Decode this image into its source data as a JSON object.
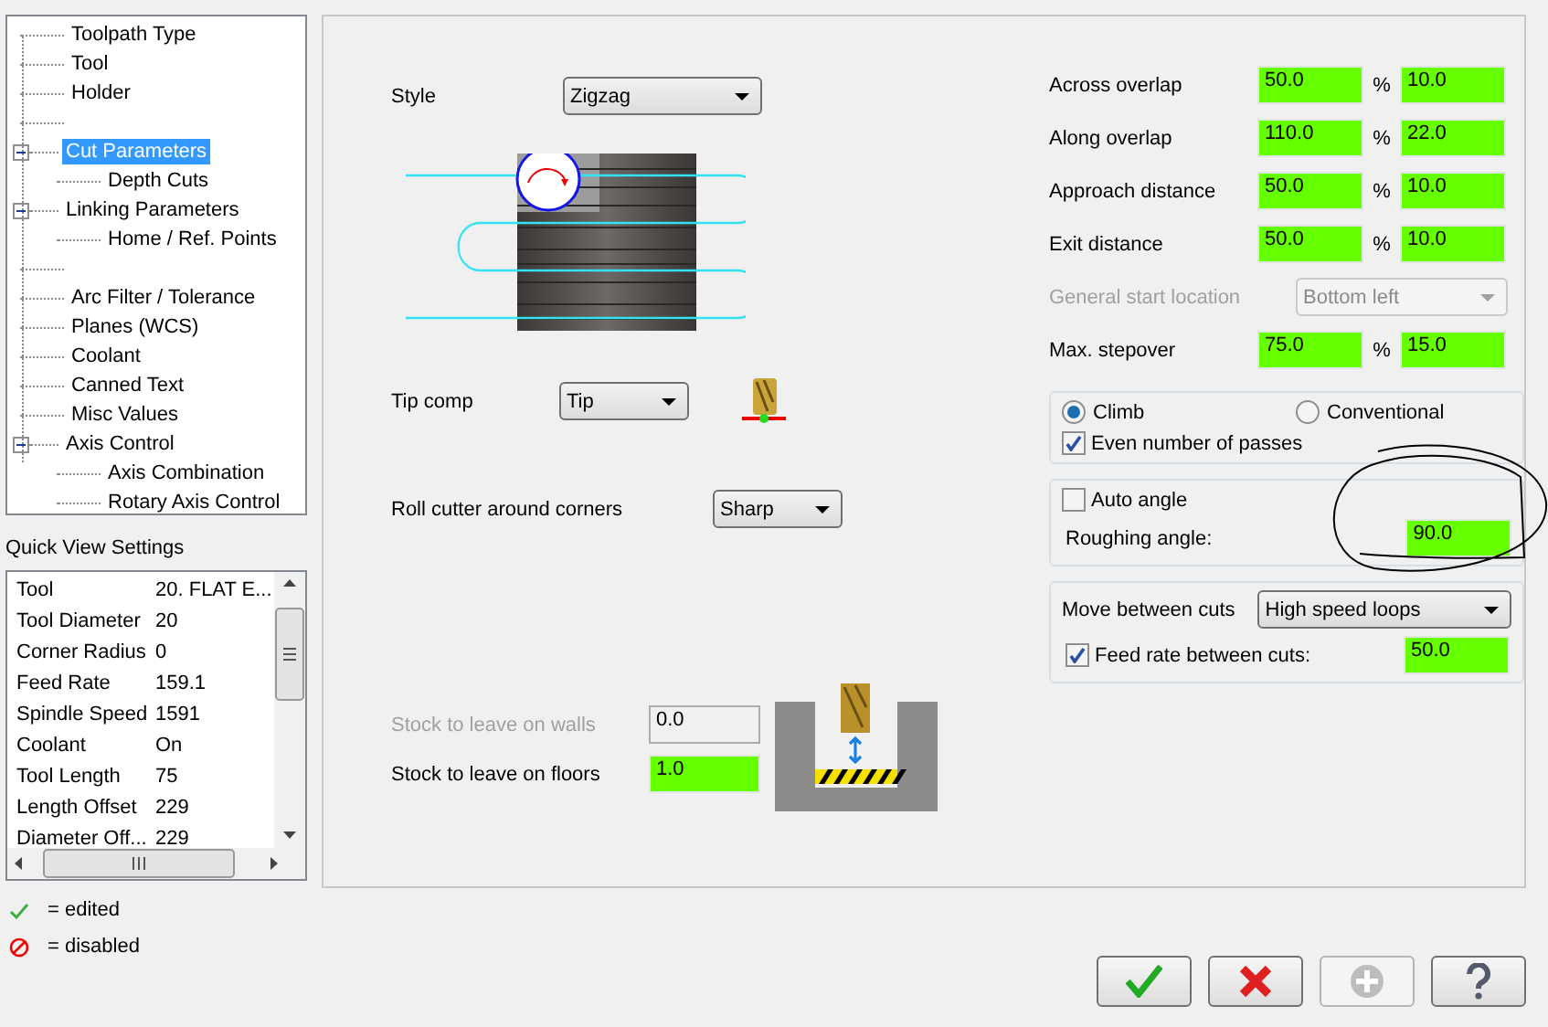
{
  "tree": [
    {
      "kind": "item",
      "label": "Toolpath Type",
      "selected": false
    },
    {
      "kind": "item",
      "label": "Tool",
      "selected": false
    },
    {
      "kind": "item",
      "label": "Holder",
      "selected": false
    },
    {
      "kind": "blank"
    },
    {
      "kind": "item",
      "label": "Cut Parameters",
      "selected": true,
      "expanded": true,
      "children": [
        {
          "kind": "item",
          "label": "Depth Cuts",
          "selected": false
        }
      ]
    },
    {
      "kind": "item",
      "label": "Linking Parameters",
      "selected": false,
      "expanded": true,
      "children": [
        {
          "kind": "item",
          "label": "Home / Ref. Points",
          "selected": false
        }
      ]
    },
    {
      "kind": "blank"
    },
    {
      "kind": "item",
      "label": "Arc Filter / Tolerance",
      "selected": false
    },
    {
      "kind": "item",
      "label": "Planes (WCS)",
      "selected": false
    },
    {
      "kind": "item",
      "label": "Coolant",
      "selected": false
    },
    {
      "kind": "item",
      "label": "Canned Text",
      "selected": false
    },
    {
      "kind": "item",
      "label": "Misc Values",
      "selected": false
    },
    {
      "kind": "item",
      "label": "Axis Control",
      "selected": false,
      "expanded": true,
      "children": [
        {
          "kind": "item",
          "label": "Axis Combination",
          "selected": false
        },
        {
          "kind": "item",
          "label": "Rotary Axis Control",
          "selected": false
        }
      ]
    }
  ],
  "quick_view": {
    "title": "Quick View Settings",
    "rows": [
      {
        "label": "Tool",
        "value": "20. FLAT E..."
      },
      {
        "label": "Tool Diameter",
        "value": "20"
      },
      {
        "label": "Corner Radius",
        "value": "0"
      },
      {
        "label": "Feed Rate",
        "value": "159.1"
      },
      {
        "label": "Spindle Speed",
        "value": "1591"
      },
      {
        "label": "Coolant",
        "value": "On"
      },
      {
        "label": "Tool Length",
        "value": "75"
      },
      {
        "label": "Length Offset",
        "value": "229"
      },
      {
        "label": "Diameter Off...",
        "value": "229"
      }
    ]
  },
  "legend": [
    {
      "kind": "edited",
      "label": "= edited"
    },
    {
      "kind": "disabled",
      "label": "= disabled"
    }
  ],
  "style": {
    "label": "Style",
    "value": "Zigzag"
  },
  "tip_comp": {
    "label": "Tip comp",
    "value": "Tip"
  },
  "roll_cutter": {
    "label": "Roll cutter around corners",
    "value": "Sharp"
  },
  "stock": [
    {
      "label": "Stock to leave on walls",
      "value": "0.0",
      "disabled": true,
      "edited": false
    },
    {
      "label": "Stock to leave on floors",
      "value": "1.0",
      "disabled": false,
      "edited": true
    }
  ],
  "params": [
    {
      "kind": "pair",
      "label": "Across overlap",
      "percent": "50.0",
      "unit": "%",
      "value": "10.0",
      "edited": true
    },
    {
      "kind": "pair",
      "label": "Along overlap",
      "percent": "110.0",
      "unit": "%",
      "value": "22.0",
      "edited": true
    },
    {
      "kind": "pair",
      "label": "Approach distance",
      "percent": "50.0",
      "unit": "%",
      "value": "10.0",
      "edited": true
    },
    {
      "kind": "pair",
      "label": "Exit distance",
      "percent": "50.0",
      "unit": "%",
      "value": "10.0",
      "edited": true
    },
    {
      "kind": "dropdown",
      "label": "General start location",
      "value": "Bottom left",
      "disabled": true
    },
    {
      "kind": "pair",
      "label": "Max. stepover",
      "percent": "75.0",
      "unit": "%",
      "value": "15.0",
      "edited": true
    }
  ],
  "direction": [
    {
      "label": "Climb",
      "selected": true
    },
    {
      "label": "Conventional",
      "selected": false
    }
  ],
  "even_passes": {
    "label": "Even number of passes",
    "checked": true
  },
  "auto_angle": {
    "label": "Auto angle",
    "checked": false
  },
  "roughing_angle": {
    "label": "Roughing angle:",
    "value": "90.0",
    "edited": true
  },
  "move_between_cuts": {
    "label": "Move between cuts",
    "value": "High speed loops"
  },
  "feed_between_cuts": {
    "label": "Feed rate between cuts:",
    "checked": true,
    "value": "50.0",
    "edited": true
  },
  "buttons": [
    {
      "kind": "ok",
      "disabled": false
    },
    {
      "kind": "cancel",
      "disabled": false
    },
    {
      "kind": "add",
      "disabled": true
    },
    {
      "kind": "help",
      "disabled": false
    }
  ]
}
